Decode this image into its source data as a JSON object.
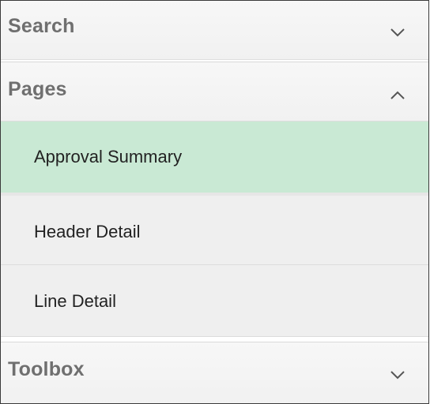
{
  "sections": {
    "search": {
      "title": "Search",
      "icon": "chevron-down-icon"
    },
    "pages": {
      "title": "Pages",
      "icon": "chevron-up-icon",
      "items": [
        {
          "label": "Approval Summary",
          "selected": true
        },
        {
          "label": "Header Detail",
          "selected": false
        },
        {
          "label": "Line Detail",
          "selected": false
        }
      ]
    },
    "toolbox": {
      "title": "Toolbox",
      "icon": "chevron-down-icon"
    }
  },
  "colors": {
    "selected_item": "#c9e9d4",
    "header_text": "#6f6f6f",
    "item_text": "#222222"
  }
}
